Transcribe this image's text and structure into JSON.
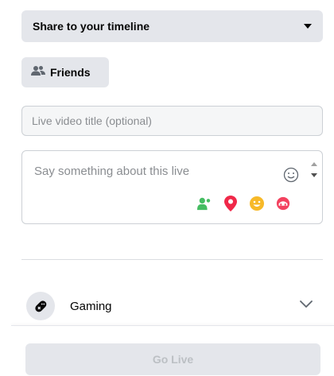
{
  "audience_select": {
    "label": "Share to your timeline",
    "icon": "caret-down-icon"
  },
  "privacy_button": {
    "label": "Friends",
    "icon": "friends-icon"
  },
  "title_input": {
    "placeholder": "Live video title (optional)"
  },
  "description": {
    "placeholder": "Say something about this live",
    "emoji_icon": "smiley-icon",
    "actions": [
      {
        "icon": "tag-friends-icon",
        "color": "#45bd62"
      },
      {
        "icon": "location-pin-icon",
        "color": "#f02849"
      },
      {
        "icon": "feeling-icon",
        "color": "#f7b928"
      },
      {
        "icon": "support-icon",
        "color": "#f3425f"
      }
    ]
  },
  "category": {
    "label": "Gaming",
    "icon": "game-controller-icon",
    "chevron": "chevron-down-icon"
  },
  "go_live_button": {
    "label": "Go Live"
  }
}
